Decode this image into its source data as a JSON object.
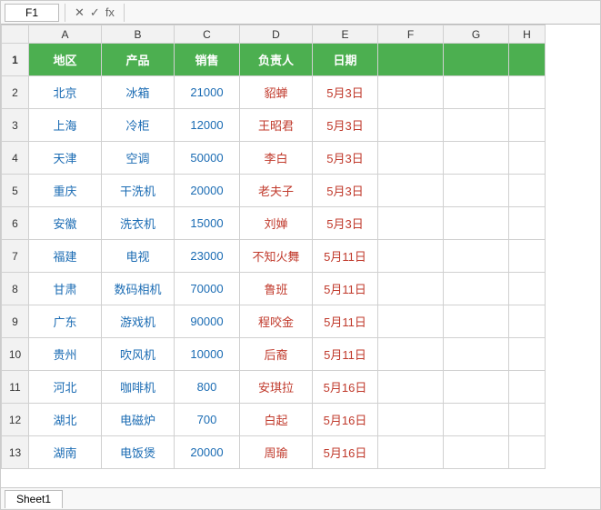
{
  "formula_bar": {
    "cell_ref": "F1",
    "fx_label": "fx"
  },
  "columns": {
    "row_num_header": "",
    "headers": [
      "A",
      "B",
      "C",
      "D",
      "E",
      "F",
      "G",
      "H"
    ]
  },
  "header_row": {
    "row_num": "1",
    "region": "地区",
    "product": "产品",
    "sales": "销售",
    "person": "负责人",
    "date": "日期"
  },
  "rows": [
    {
      "row_num": "2",
      "region": "北京",
      "product": "冰箱",
      "sales": "21000",
      "person": "貂蝉",
      "date": "5月3日"
    },
    {
      "row_num": "3",
      "region": "上海",
      "product": "冷柜",
      "sales": "12000",
      "person": "王昭君",
      "date": "5月3日"
    },
    {
      "row_num": "4",
      "region": "天津",
      "product": "空调",
      "sales": "50000",
      "person": "李白",
      "date": "5月3日"
    },
    {
      "row_num": "5",
      "region": "重庆",
      "product": "干洗机",
      "sales": "20000",
      "person": "老夫子",
      "date": "5月3日"
    },
    {
      "row_num": "6",
      "region": "安徽",
      "product": "洗衣机",
      "sales": "15000",
      "person": "刘婵",
      "date": "5月3日"
    },
    {
      "row_num": "7",
      "region": "福建",
      "product": "电视",
      "sales": "23000",
      "person": "不知火舞",
      "date": "5月11日"
    },
    {
      "row_num": "8",
      "region": "甘肃",
      "product": "数码相机",
      "sales": "70000",
      "person": "鲁班",
      "date": "5月11日"
    },
    {
      "row_num": "9",
      "region": "广东",
      "product": "游戏机",
      "sales": "90000",
      "person": "程咬金",
      "date": "5月11日"
    },
    {
      "row_num": "10",
      "region": "贵州",
      "product": "吹风机",
      "sales": "10000",
      "person": "后裔",
      "date": "5月11日"
    },
    {
      "row_num": "11",
      "region": "河北",
      "product": "咖啡机",
      "sales": "800",
      "person": "安琪拉",
      "date": "5月16日"
    },
    {
      "row_num": "12",
      "region": "湖北",
      "product": "电磁炉",
      "sales": "700",
      "person": "白起",
      "date": "5月16日"
    },
    {
      "row_num": "13",
      "region": "湖南",
      "product": "电饭煲",
      "sales": "20000",
      "person": "周瑜",
      "date": "5月16日"
    }
  ],
  "sheet_tab": {
    "label": "Sheet1"
  }
}
